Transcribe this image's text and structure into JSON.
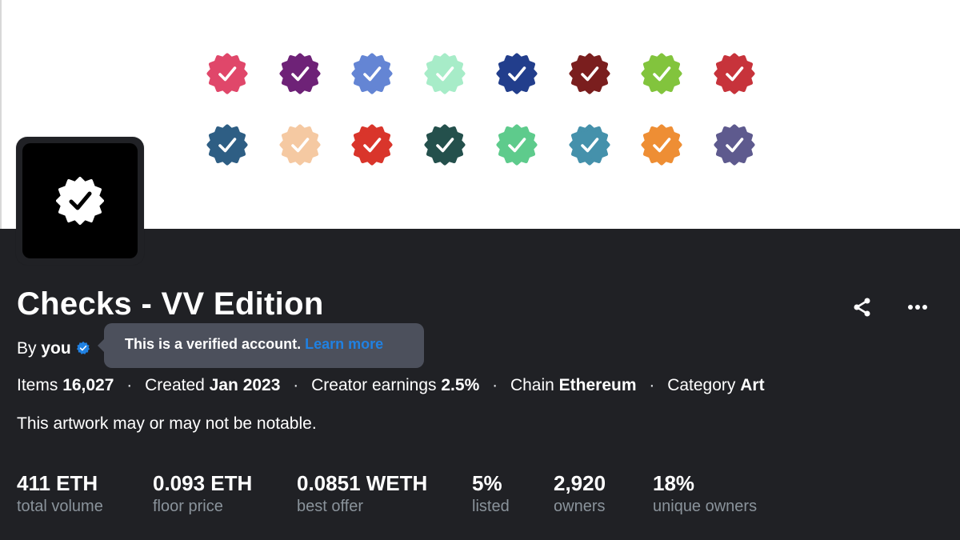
{
  "badges": [
    {
      "color": "#e0476a"
    },
    {
      "color": "#6e2277"
    },
    {
      "color": "#6485d4"
    },
    {
      "color": "#a7ecc8"
    },
    {
      "color": "#223e8c"
    },
    {
      "color": "#7a1e1e"
    },
    {
      "color": "#82c43d"
    },
    {
      "color": "#c7333b"
    },
    {
      "color": "#2e5e84"
    },
    {
      "color": "#f5c9a2"
    },
    {
      "color": "#d9352b"
    },
    {
      "color": "#24504c"
    },
    {
      "color": "#5ecb8c"
    },
    {
      "color": "#4591ab"
    },
    {
      "color": "#ee8e34"
    },
    {
      "color": "#5e5a8e"
    }
  ],
  "collection": {
    "title": "Checks - VV Edition",
    "by_prefix": "By",
    "creator": "you",
    "description": "This artwork may or may not be notable."
  },
  "tooltip": {
    "text": "This is a verified account.",
    "link": "Learn more"
  },
  "details": {
    "items_label": "Items",
    "items_value": "16,027",
    "created_label": "Created",
    "created_value": "Jan 2023",
    "earnings_label": "Creator earnings",
    "earnings_value": "2.5%",
    "chain_label": "Chain",
    "chain_value": "Ethereum",
    "category_label": "Category",
    "category_value": "Art",
    "separator": "·"
  },
  "stats": [
    {
      "value": "411 ETH",
      "label": "total volume"
    },
    {
      "value": "0.093 ETH",
      "label": "floor price"
    },
    {
      "value": "0.0851 WETH",
      "label": "best offer"
    },
    {
      "value": "5%",
      "label": "listed"
    },
    {
      "value": "2,920",
      "label": "owners"
    },
    {
      "value": "18%",
      "label": "unique owners"
    }
  ],
  "actions": {
    "share_icon": "share-icon",
    "more_icon": "more-horizontal-icon"
  },
  "colors": {
    "background": "#202125",
    "accent_blue": "#2081e2",
    "muted_text": "#8a939b"
  }
}
